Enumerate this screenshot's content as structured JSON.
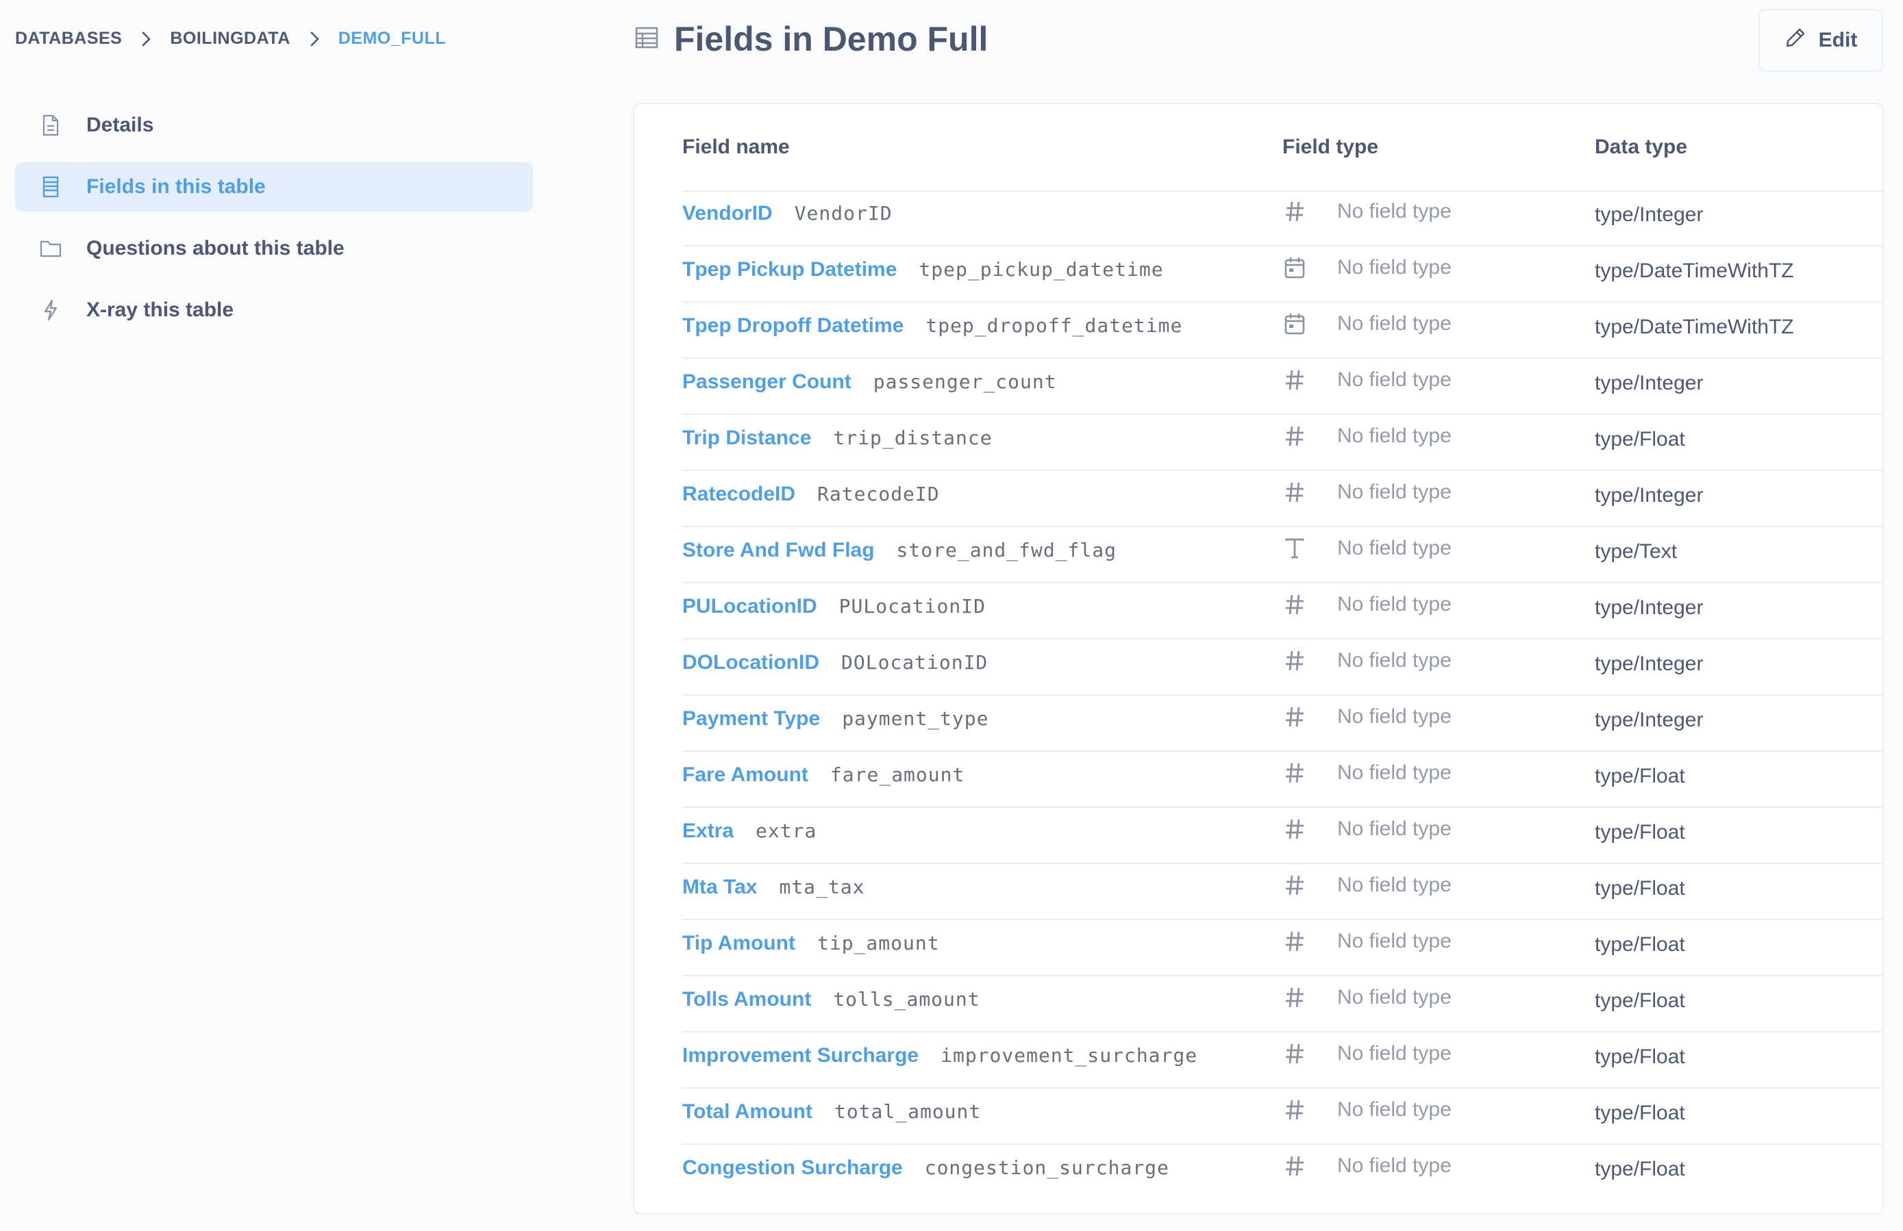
{
  "breadcrumb": [
    "DATABASES",
    "BOILINGDATA",
    "DEMO_FULL"
  ],
  "sidebar": {
    "items": [
      {
        "label": "Details",
        "icon": "document-icon"
      },
      {
        "label": "Fields in this table",
        "icon": "table-list-icon",
        "active": true
      },
      {
        "label": "Questions about this table",
        "icon": "folder-icon"
      },
      {
        "label": "X-ray this table",
        "icon": "bolt-icon"
      }
    ]
  },
  "header": {
    "title": "Fields in Demo Full",
    "edit_label": "Edit"
  },
  "table": {
    "columns": [
      "Field name",
      "Field type",
      "Data type"
    ],
    "rows": [
      {
        "display": "VendorID",
        "name": "VendorID",
        "icon": "number-icon",
        "field_type": "No field type",
        "data_type": "type/Integer"
      },
      {
        "display": "Tpep Pickup Datetime",
        "name": "tpep_pickup_datetime",
        "icon": "calendar-icon",
        "field_type": "No field type",
        "data_type": "type/DateTimeWithTZ"
      },
      {
        "display": "Tpep Dropoff Datetime",
        "name": "tpep_dropoff_datetime",
        "icon": "calendar-icon",
        "field_type": "No field type",
        "data_type": "type/DateTimeWithTZ"
      },
      {
        "display": "Passenger Count",
        "name": "passenger_count",
        "icon": "number-icon",
        "field_type": "No field type",
        "data_type": "type/Integer"
      },
      {
        "display": "Trip Distance",
        "name": "trip_distance",
        "icon": "number-icon",
        "field_type": "No field type",
        "data_type": "type/Float"
      },
      {
        "display": "RatecodeID",
        "name": "RatecodeID",
        "icon": "number-icon",
        "field_type": "No field type",
        "data_type": "type/Integer"
      },
      {
        "display": "Store And Fwd Flag",
        "name": "store_and_fwd_flag",
        "icon": "text-icon",
        "field_type": "No field type",
        "data_type": "type/Text"
      },
      {
        "display": "PULocationID",
        "name": "PULocationID",
        "icon": "number-icon",
        "field_type": "No field type",
        "data_type": "type/Integer"
      },
      {
        "display": "DOLocationID",
        "name": "DOLocationID",
        "icon": "number-icon",
        "field_type": "No field type",
        "data_type": "type/Integer"
      },
      {
        "display": "Payment Type",
        "name": "payment_type",
        "icon": "number-icon",
        "field_type": "No field type",
        "data_type": "type/Integer"
      },
      {
        "display": "Fare Amount",
        "name": "fare_amount",
        "icon": "number-icon",
        "field_type": "No field type",
        "data_type": "type/Float"
      },
      {
        "display": "Extra",
        "name": "extra",
        "icon": "number-icon",
        "field_type": "No field type",
        "data_type": "type/Float"
      },
      {
        "display": "Mta Tax",
        "name": "mta_tax",
        "icon": "number-icon",
        "field_type": "No field type",
        "data_type": "type/Float"
      },
      {
        "display": "Tip Amount",
        "name": "tip_amount",
        "icon": "number-icon",
        "field_type": "No field type",
        "data_type": "type/Float"
      },
      {
        "display": "Tolls Amount",
        "name": "tolls_amount",
        "icon": "number-icon",
        "field_type": "No field type",
        "data_type": "type/Float"
      },
      {
        "display": "Improvement Surcharge",
        "name": "improvement_surcharge",
        "icon": "number-icon",
        "field_type": "No field type",
        "data_type": "type/Float"
      },
      {
        "display": "Total Amount",
        "name": "total_amount",
        "icon": "number-icon",
        "field_type": "No field type",
        "data_type": "type/Float"
      },
      {
        "display": "Congestion Surcharge",
        "name": "congestion_surcharge",
        "icon": "number-icon",
        "field_type": "No field type",
        "data_type": "type/Float"
      }
    ]
  },
  "colors": {
    "accent": "#509ee3",
    "text": "#4c5773",
    "muted": "#949aab",
    "active_bg": "#e4eefa",
    "border": "#eceff2"
  }
}
